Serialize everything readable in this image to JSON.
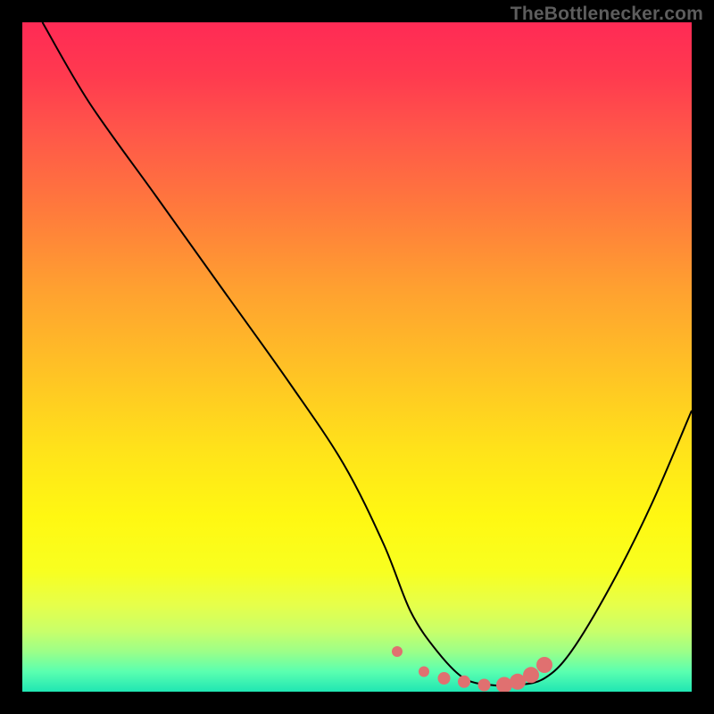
{
  "watermark": "TheBottlenecker.com",
  "colors": {
    "line": "#000000",
    "dot_fill": "#e07070",
    "dot_stroke": "#c95858"
  },
  "chart_data": {
    "type": "line",
    "title": "",
    "xlabel": "",
    "ylabel": "",
    "xlim": [
      0,
      100
    ],
    "ylim": [
      0,
      100
    ],
    "series": [
      {
        "name": "curve",
        "x": [
          3,
          10,
          20,
          30,
          40,
          48,
          54,
          58,
          62,
          66,
          70,
          74,
          78,
          82,
          88,
          94,
          100
        ],
        "y": [
          100,
          88,
          74,
          60,
          46,
          34,
          22,
          12,
          6,
          2,
          1,
          1,
          2,
          6,
          16,
          28,
          42
        ]
      }
    ],
    "highlight_points": [
      {
        "x": 56,
        "y": 6
      },
      {
        "x": 60,
        "y": 3
      },
      {
        "x": 63,
        "y": 2
      },
      {
        "x": 66,
        "y": 1.5
      },
      {
        "x": 69,
        "y": 1
      },
      {
        "x": 72,
        "y": 1
      },
      {
        "x": 74,
        "y": 1.5
      },
      {
        "x": 76,
        "y": 2.5
      },
      {
        "x": 78,
        "y": 4
      }
    ]
  }
}
